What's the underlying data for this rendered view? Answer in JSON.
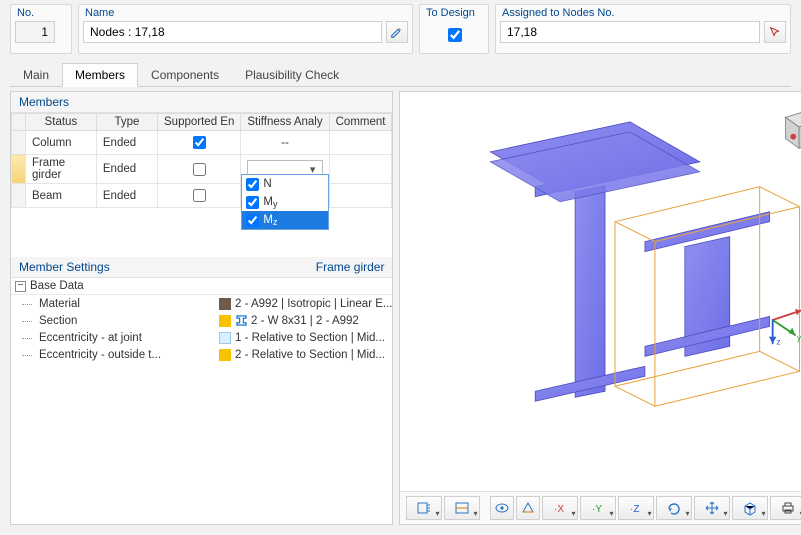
{
  "header": {
    "no_label": "No.",
    "no_value": "1",
    "name_label": "Name",
    "name_value": "Nodes : 17,18",
    "todesign_label": "To Design",
    "todesign_checked": true,
    "assigned_label": "Assigned to Nodes No.",
    "assigned_value": "17,18"
  },
  "tabs": {
    "main": "Main",
    "members": "Members",
    "components": "Components",
    "plausibility": "Plausibility Check"
  },
  "members_section_title": "Members",
  "grid": {
    "headers": {
      "status": "Status",
      "type": "Type",
      "supported": "Supported En",
      "stiffness": "Stiffness Analy",
      "comment": "Comment"
    },
    "rows": [
      {
        "status": "Column",
        "type": "Ended",
        "supported": true,
        "stiffness_display": "--"
      },
      {
        "status": "Frame girder",
        "type": "Ended",
        "supported": false,
        "stiffness_display": ""
      },
      {
        "status": "Beam",
        "type": "Ended",
        "supported": false,
        "stiffness_display": ""
      }
    ]
  },
  "stiffness_popup": {
    "items": [
      {
        "label": "N",
        "checked": true,
        "selected": false
      },
      {
        "label": "My",
        "checked": true,
        "selected": false
      },
      {
        "label": "Mz",
        "checked": true,
        "selected": true
      }
    ]
  },
  "settings": {
    "title": "Member Settings",
    "subject": "Frame girder",
    "group": "Base Data",
    "rows": [
      {
        "key": "Material",
        "swatch": "#6e594b",
        "icon": "",
        "value": "2 - A992 | Isotropic | Linear E..."
      },
      {
        "key": "Section",
        "swatch": "#f7c300",
        "icon": "ibeam",
        "value": "2 - W 8x31 | 2 - A992"
      },
      {
        "key": "Eccentricity - at joint",
        "swatch": "#d9efff",
        "icon": "",
        "value": "1 - Relative to Section | Mid..."
      },
      {
        "key": "Eccentricity - outside t...",
        "swatch": "#f7c300",
        "icon": "",
        "value": "2 - Relative to Section | Mid..."
      }
    ]
  },
  "toolbar": {
    "buttons": [
      "view-settings-icon",
      "zoom-extents-icon",
      "divider",
      "show-hide-icon",
      "perspective-icon",
      "view-x-icon",
      "view-y-icon",
      "view-z-icon",
      "rotate-icon",
      "pan-icon",
      "show-box-icon",
      "print-icon",
      "divider",
      "delete-view-icon"
    ]
  }
}
